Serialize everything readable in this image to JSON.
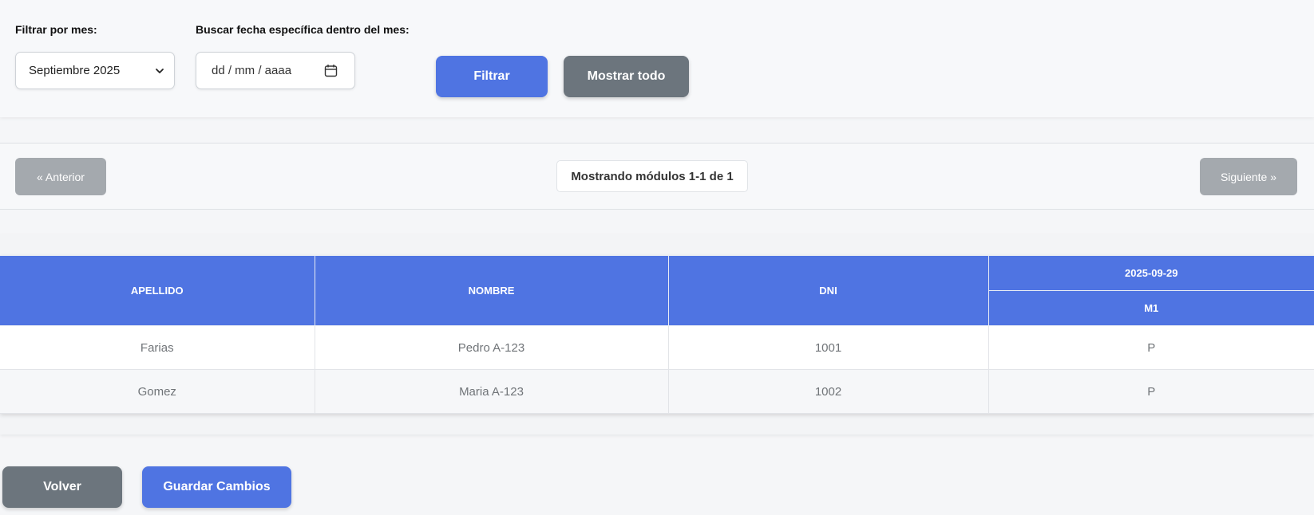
{
  "filters": {
    "month_label": "Filtrar por mes:",
    "month_value": "Septiembre 2025",
    "date_label": "Buscar fecha específica dentro del mes:",
    "date_placeholder": "dd / mm / aaaa",
    "filter_button": "Filtrar",
    "show_all_button": "Mostrar todo"
  },
  "pagination": {
    "prev": "« Anterior",
    "info": "Mostrando módulos 1-1 de 1",
    "next": "Siguiente »"
  },
  "table": {
    "headers": {
      "apellido": "APELLIDO",
      "nombre": "NOMBRE",
      "dni": "DNI",
      "date": "2025-09-29",
      "module": "M1"
    },
    "rows": [
      {
        "apellido": "Farias",
        "nombre": "Pedro A-123",
        "dni": "1001",
        "m1": "P"
      },
      {
        "apellido": "Gomez",
        "nombre": "Maria A-123",
        "dni": "1002",
        "m1": "P"
      }
    ]
  },
  "actions": {
    "back": "Volver",
    "save": "Guardar Cambios"
  },
  "colors": {
    "primary": "#4f74e2",
    "secondary": "#6c757d",
    "disabled": "#a4a9ae"
  },
  "icons": {
    "select": "chevron-down-icon",
    "date": "calendar-icon"
  }
}
